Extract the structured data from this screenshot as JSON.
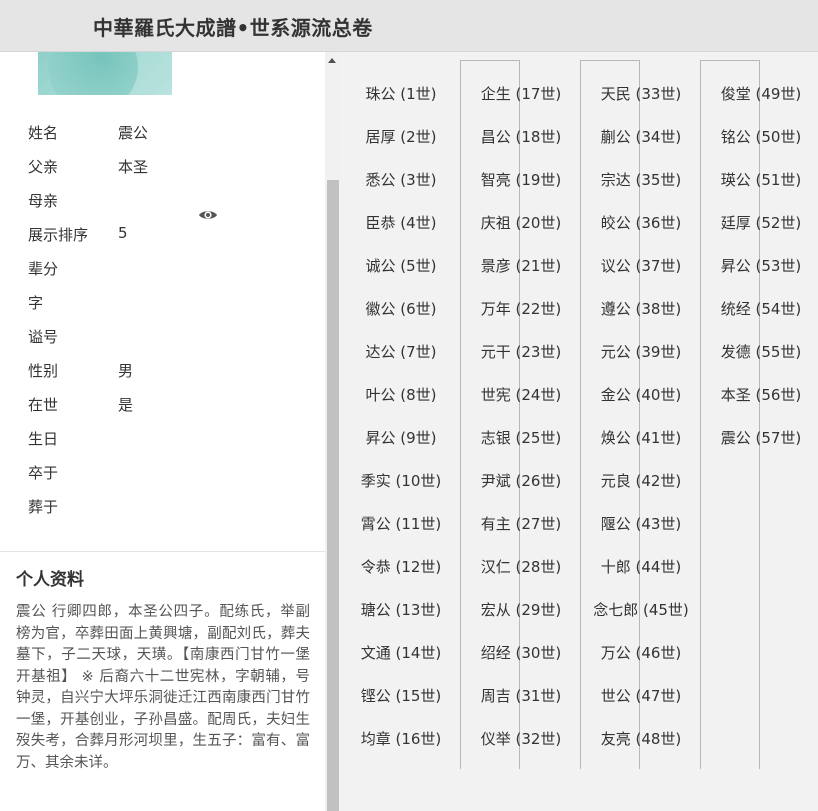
{
  "header": {
    "title": "中華羅氏大成譜•世系源流总卷"
  },
  "profile": {
    "fields": [
      {
        "label": "姓名",
        "value": "震公"
      },
      {
        "label": "父亲",
        "value": "本圣"
      },
      {
        "label": "母亲",
        "value": ""
      },
      {
        "label": "展示排序",
        "value": "5"
      },
      {
        "label": "辈分",
        "value": ""
      },
      {
        "label": "字",
        "value": ""
      },
      {
        "label": "谥号",
        "value": ""
      },
      {
        "label": "性别",
        "value": "男"
      },
      {
        "label": "在世",
        "value": "是"
      },
      {
        "label": "生日",
        "value": ""
      },
      {
        "label": "卒于",
        "value": ""
      },
      {
        "label": "葬于",
        "value": ""
      }
    ]
  },
  "personal": {
    "title": "个人资料",
    "bio": "震公  行卿四郎，本圣公四子。配练氏，举副榜为官，卒葬田面上黄興塘，副配刘氏，葬夫墓下，子二天球，天璜。【南康西门甘竹一堡开基祖】 ※ 后裔六十二世宪林，字朝辅，号钟灵，自兴宁大坪乐洞徙迁江西南康西门甘竹一堡，开基创业，子孙昌盛。配周氏，夫妇生歿失考，合葬月形河坝里，生五子：富有、富万、其余未详。"
  },
  "generations": [
    "珠公 (1世)",
    "居厚 (2世)",
    "悉公 (3世)",
    "臣恭 (4世)",
    "诚公 (5世)",
    "徽公 (6世)",
    "达公 (7世)",
    "叶公 (8世)",
    "昇公 (9世)",
    "季实 (10世)",
    "霄公 (11世)",
    "令恭 (12世)",
    "瑭公 (13世)",
    "文通 (14世)",
    "铿公 (15世)",
    "均章 (16世)",
    "企生 (17世)",
    "昌公 (18世)",
    "智亮 (19世)",
    "庆祖 (20世)",
    "景彦 (21世)",
    "万年 (22世)",
    "元干 (23世)",
    "世宪 (24世)",
    "志银 (25世)",
    "尹斌 (26世)",
    "有主 (27世)",
    "汉仁 (28世)",
    "宏从 (29世)",
    "绍经 (30世)",
    "周吉 (31世)",
    "仪举 (32世)",
    "天民 (33世)",
    "蒯公 (34世)",
    "宗达 (35世)",
    "皎公 (36世)",
    "议公 (37世)",
    "遵公 (38世)",
    "元公 (39世)",
    "金公 (40世)",
    "焕公 (41世)",
    "元良 (42世)",
    "隁公 (43世)",
    "十郎 (44世)",
    "念七郎 (45世)",
    "万公 (46世)",
    "世公 (47世)",
    "友亮 (48世)",
    "俊堂 (49世)",
    "铭公 (50世)",
    "瑛公 (51世)",
    "廷厚 (52世)",
    "昇公 (53世)",
    "统经 (54世)",
    "发德 (55世)",
    "本圣 (56世)",
    "震公 (57世)"
  ],
  "icons": {
    "eye": "eye-icon",
    "scroll_up": "scroll-up-arrow-icon"
  }
}
